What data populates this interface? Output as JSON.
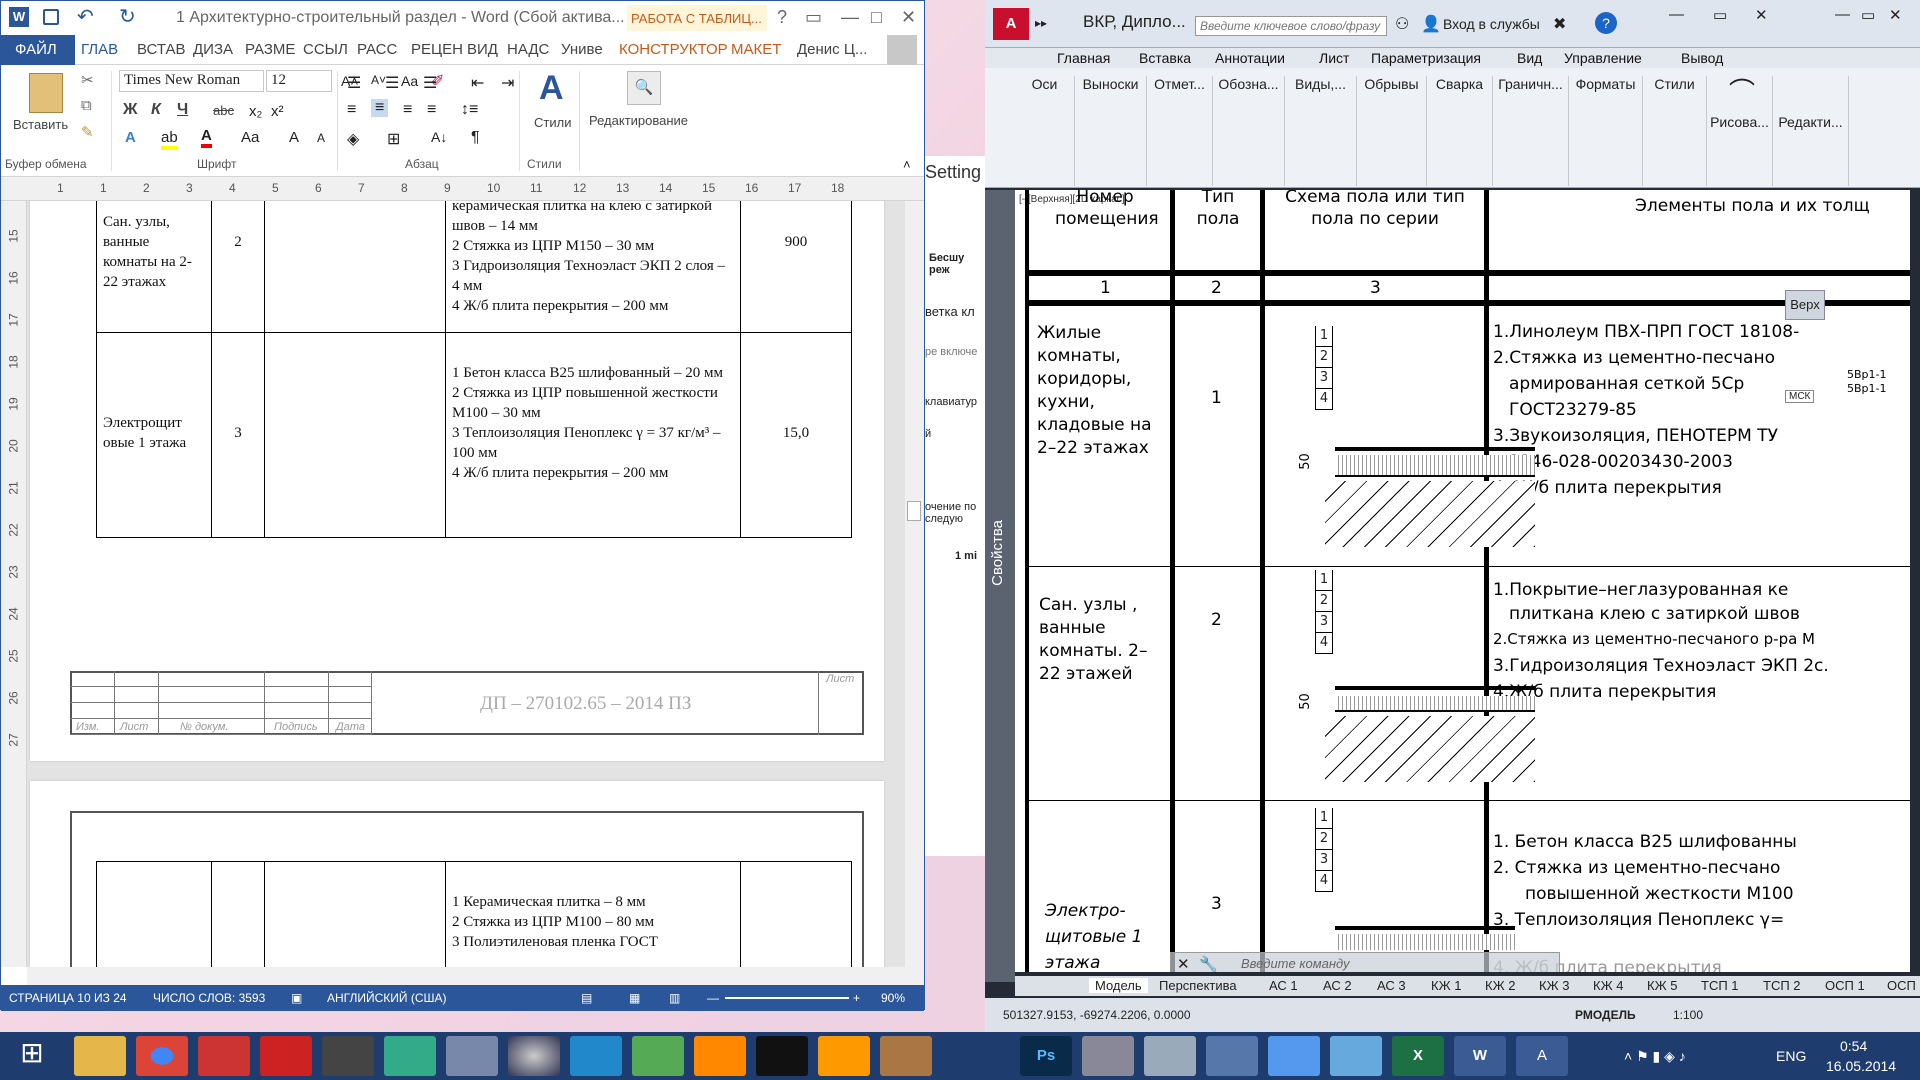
{
  "word": {
    "title": "1 Архитектурно-строительный раздел - Word (Сбой актива...",
    "tools_tab": "РАБОТА С ТАБЛИЦ...",
    "help": "?",
    "tabs": [
      "ФАЙЛ",
      "ГЛАВ",
      "ВСТАВ",
      "ДИЗА",
      "РАЗМЕ",
      "ССЫЛ",
      "РАСС",
      "РЕЦЕН",
      "ВИД",
      "НАДС",
      "Униве",
      "КОНСТРУКТОР",
      "МАКЕТ"
    ],
    "user": "Денис Ц...",
    "ribbon": {
      "paste": "Вставить",
      "clipboard": "Буфер обмена",
      "font_group": "Шрифт",
      "para_group": "Абзац",
      "styles_group": "Стили",
      "styles": "Стили",
      "editing": "Редактирование",
      "font_name": "Times New Roman",
      "font_size": "12",
      "bold": "Ж",
      "italic": "К",
      "underline": "Ч",
      "strike": "abc"
    },
    "ruler": [
      "1",
      "1",
      "2",
      "3",
      "4",
      "5",
      "6",
      "7",
      "8",
      "9",
      "10",
      "11",
      "12",
      "13",
      "14",
      "15",
      "16",
      "17",
      "18"
    ],
    "vruler": [
      "15",
      "16",
      "17",
      "18",
      "19",
      "20",
      "21",
      "22",
      "23",
      "24",
      "25",
      "26",
      "27"
    ],
    "table1": [
      {
        "name": "Сан. узлы, ванные комнаты на 2-22 этажах",
        "type": "2",
        "layers": "керамическая плитка на клею с затиркой швов – 14 мм\n2 Стяжка из ЦПР М150 – 30 мм\n3 Гидроизоляция Техноэласт ЭКП 2 слоя – 4 мм\n4 Ж/б плита перекрытия – 200 мм",
        "area": "900"
      },
      {
        "name": "Электрощит овые 1 этажа",
        "type": "3",
        "layers": "1 Бетон класса В25 шлифованный – 20 мм\n2 Стяжка из ЦПР повышенной жесткости М100 – 30 мм\n3 Теплоизоляция Пеноплекс γ = 37 кг/м³ – 100 мм\n4 Ж/б плита перекрытия – 200 мм",
        "area": "15,0"
      }
    ],
    "stamp": "ДП – 270102.65 – 2014 ПЗ",
    "stamp_sheet": "Лист",
    "stamp_cols": [
      "Изм.",
      "Лист",
      "№ докум.",
      "Подпись",
      "Дата"
    ],
    "table2_layers": "1 Керамическая плитка – 8 мм\n2 Стяжка из ЦПР М100 – 80 мм\n3 Полиэтиленовая пленка ГОСТ",
    "status": {
      "page": "СТРАНИЦА 10 ИЗ 24",
      "words": "ЧИСЛО СЛОВ: 3593",
      "lang": "АНГЛИЙСКИЙ (США)",
      "zoom": "90%"
    }
  },
  "middle": {
    "setting": "Setting",
    "items": [
      "Бесшу реж",
      "ветка кл",
      "ре включе",
      "клавиатур",
      "й",
      "очение по следую",
      "1 mi"
    ]
  },
  "acad": {
    "title": "ВКР, Дипло...",
    "search_placeholder": "Введите ключевое слово/фразу",
    "login": "Вход в службы",
    "menu": [
      "Главная",
      "Вставка",
      "Аннотации",
      "Лист",
      "Параметризация",
      "Вид",
      "Управление",
      "Вывод"
    ],
    "panels": [
      "Оси",
      "Выноски",
      "Отмет...",
      "Обозна...",
      "Виды,...",
      "Обрывы",
      "Сварка",
      "Граничн...",
      "Форматы",
      "Стили",
      "Рисова...",
      "Редакти..."
    ],
    "props": "Свойства",
    "viewport": "[-][Верхняя][2D каркас]",
    "viewcube_top": "Верх",
    "viewcube_ucs": "МСК",
    "headers": [
      "Номер помещения",
      "Тип пола",
      "Схема пола или тип пола по серии",
      "Элементы пола и их толщ"
    ],
    "colnums": [
      "1",
      "2",
      "3"
    ],
    "rows": [
      {
        "name": "Жилые комнаты, коридоры, кухни, кладовые на 2–22 этажах",
        "type": "1",
        "elements": [
          "1.Линолеум ПВХ-ПРП ГОСТ 18108-",
          "2.Стяжка из цементно-песчано",
          "армированная сеткой 5Ср",
          "ГОСТ23279-85",
          "3.Звукоизоляция, ПЕНОТЕРМ ТУ",
          "2246-028-00203430-2003",
          "4.  Ж/б плита перекрытия"
        ]
      },
      {
        "name": "Сан. узлы , ванные комнаты. 2–22 этажей",
        "type": "2",
        "elements": [
          "1.Покрытие–неглазурованная ке",
          "плиткана клею с затиркой швов",
          "2.Стяжка из цементно-песчаного р-ра М",
          "3.Гидроизоляция Техноэласт ЭКП 2с.",
          "4.Ж/б плита перекрытия"
        ]
      },
      {
        "name": "Электро- щитовые 1 этажа",
        "type": "3",
        "elements": [
          "1.  Бетон класса В25 шлифованны",
          "2.  Стяжка из цементно-песчано",
          "повышенной жесткости М100",
          "3.   Теплоизоляция Пеноплекс γ=",
          "4.  Ж/б плита перекрытия"
        ]
      }
    ],
    "scheme_nums": [
      "1",
      "2",
      "3",
      "4"
    ],
    "dim": "50",
    "mesh_label": "5Вр1-1",
    "mesh_label2": "5Вр1-1",
    "cmd_placeholder": "Введите команду",
    "layout_tabs": [
      "Модель",
      "Перспектива",
      "АС 1",
      "АС 2",
      "АС 3",
      "КЖ 1",
      "КЖ 2",
      "КЖ 3",
      "КЖ 4",
      "КЖ 5",
      "ТСП 1",
      "ТСП 2",
      "ОСП 1",
      "ОСП"
    ],
    "coords": "501327.9153, -69274.2206, 0.0000",
    "mode": "РМОДЕЛЬ",
    "scale": "1:100"
  },
  "taskbar": {
    "lang": "ENG",
    "time": "0:54",
    "date": "16.05.2014"
  }
}
